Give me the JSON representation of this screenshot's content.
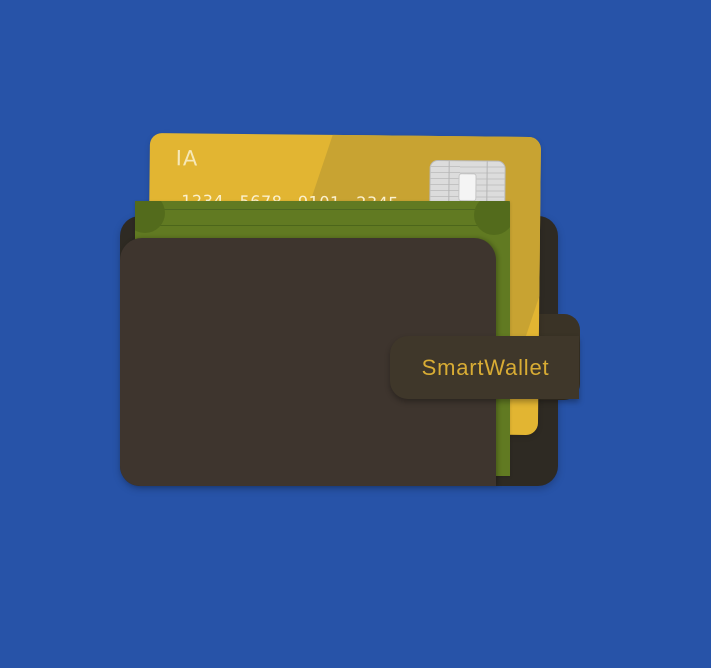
{
  "scene": {
    "background_color": "#2753a8",
    "wallet_color": "#3e352e",
    "wallet_back_color": "#2e2a23",
    "cash_color": "#617a22",
    "card_color": "#e2b532"
  },
  "card": {
    "brand": "IA",
    "number": "1234 5678 9101 2345",
    "chip_icon": "chip-icon"
  },
  "strap": {
    "label": "SmartWallet",
    "label_color": "#d8ac34"
  }
}
